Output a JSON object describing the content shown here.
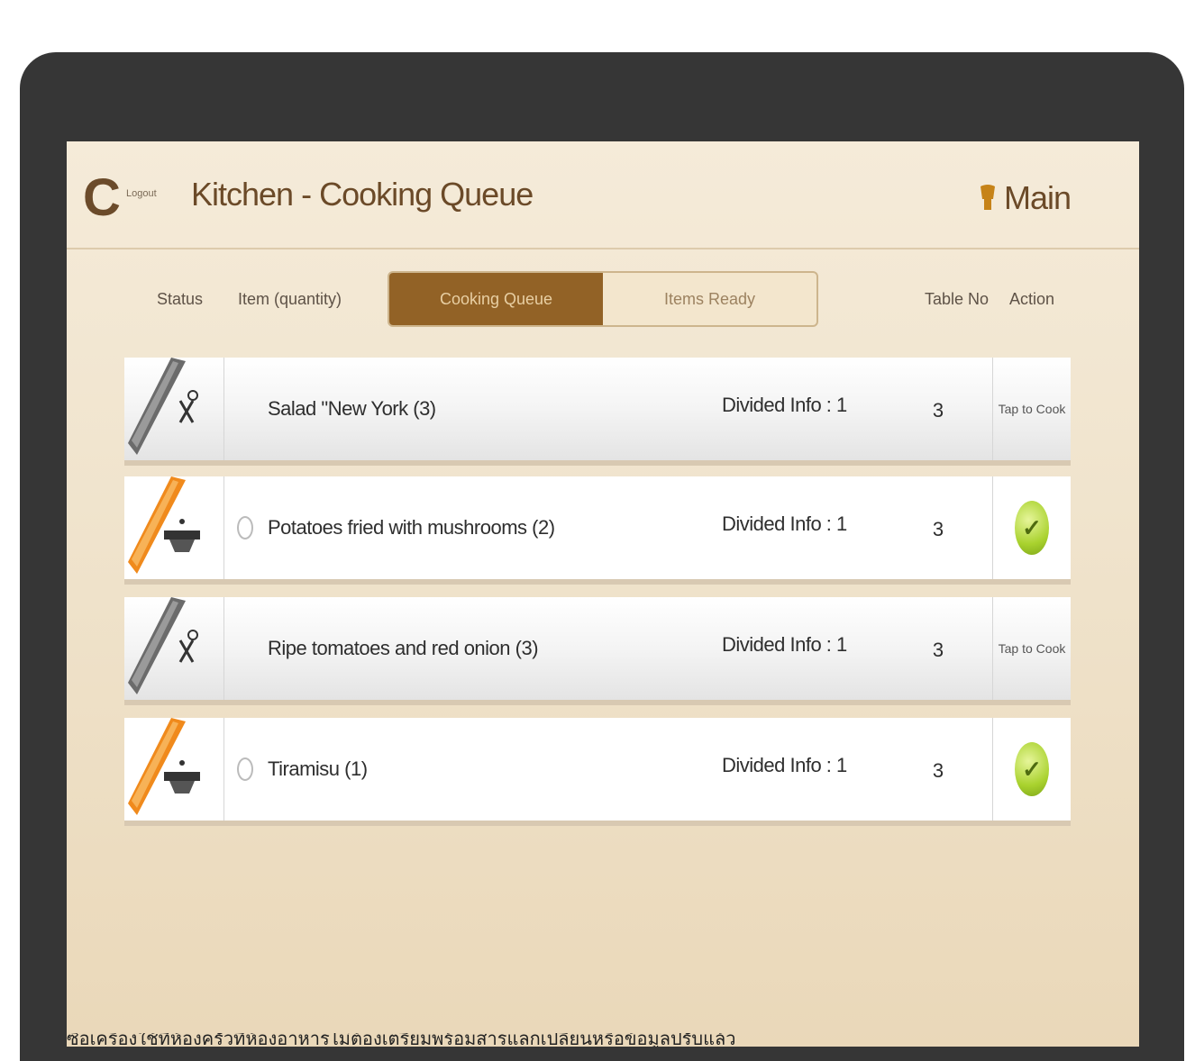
{
  "header": {
    "logout_label": "Logout",
    "title": "Kitchen - Cooking Queue",
    "main_label": "Main"
  },
  "columns": {
    "status": "Status",
    "item": "Item (quantity)",
    "table_no": "Table No",
    "action": "Action"
  },
  "segments": [
    {
      "label": "Cooking Queue",
      "active": true
    },
    {
      "label": "Items Ready",
      "active": false
    }
  ],
  "rows": [
    {
      "item": "Salad \"New York (3)",
      "info": "Divided Info : 1",
      "table": "3",
      "action": "Tap to Cook",
      "status": "pending",
      "status_color": "#6b6b6b"
    },
    {
      "item": "Potatoes fried with mushrooms (2)",
      "info": "Divided Info : 1",
      "table": "3",
      "action": "done",
      "status": "cooking",
      "status_color": "#f08a1c"
    },
    {
      "item": "Ripe tomatoes and red onion (3)",
      "info": "Divided Info : 1",
      "table": "3",
      "action": "Tap to Cook",
      "status": "pending",
      "status_color": "#6b6b6b"
    },
    {
      "item": "Tiramisu (1)",
      "info": "Divided Info : 1",
      "table": "3",
      "action": "done",
      "status": "cooking",
      "status_color": "#f08a1c"
    }
  ],
  "icons": {
    "logo": "c-logo-icon",
    "main": "chef-hat-icon",
    "pending": "utensils-icon",
    "cooking": "pot-icon",
    "done": "check-icon"
  },
  "footer_caption": "ซื้อเครื่องใช้ที่ห้องครัวที่ห้องอาหารไม่ต้องเตรียมพร้อมสารแลกเปลี่ยนหรือข้อมูลปรับแล้ว"
}
